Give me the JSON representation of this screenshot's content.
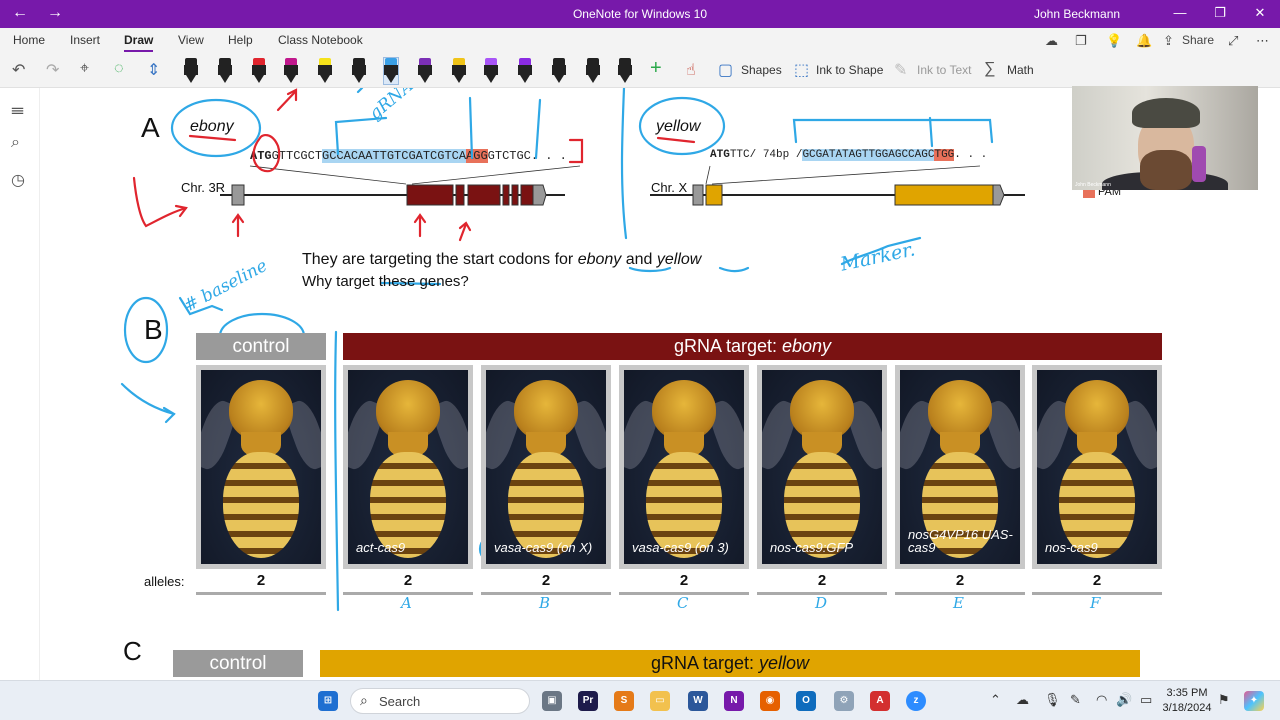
{
  "window": {
    "title": "OneNote for Windows 10",
    "user": "John Beckmann",
    "back_icon": "←",
    "forward_icon": "→",
    "minimize": "—",
    "maximize": "❐",
    "close": "✕"
  },
  "ribbon": {
    "tabs": [
      "Home",
      "Insert",
      "Draw",
      "View",
      "Help",
      "Class Notebook"
    ],
    "share": "Share"
  },
  "toolbar": {
    "shapes": "Shapes",
    "ink_to_shape": "Ink to Shape",
    "ink_to_text": "Ink to Text",
    "math": "Math",
    "pen_colors": [
      "#222222",
      "#222222",
      "#e0252e",
      "#c0188c",
      "#f5e21a",
      "#222222",
      "#3aa0e6",
      "#7b2fb5",
      "#f0c419",
      "#a855f7",
      "#8a2be2",
      "#222222",
      "#222222",
      "#222222"
    ]
  },
  "panelA": {
    "letter": "A",
    "ebony": "ebony",
    "yellow": "yellow",
    "chr3r": "Chr. 3R",
    "chrx": "Chr. X",
    "seq_ebony": {
      "start": "ATG",
      "pre": "GTTCGCT",
      "guide": "GCCACAATTGTCGATCGTC",
      "mid": "A",
      "pam": "AGG",
      "post": "GTCTGC. . ."
    },
    "seq_yellow": {
      "start": "ATG",
      "pre": "TTC/ 74bp /",
      "guide": "GCGATATAGTTGGAGCCAGC",
      "pam": "TGG",
      "post": ". . ."
    },
    "pam_legend": "PAM",
    "question1_pre": "They are targeting the start codons for ",
    "question1_ebony": "ebony",
    "question1_and": " and ",
    "question1_yellow": "yellow",
    "question2": "Why target these genes?"
  },
  "panelB": {
    "letter": "B",
    "control": "control",
    "target_label": "gRNA target: ",
    "target_gene": "ebony",
    "alleles_label": "alleles:",
    "flies": [
      {
        "caption": "",
        "alleles": "2",
        "letter": ""
      },
      {
        "caption": "act-cas9",
        "alleles": "2",
        "letter": "A"
      },
      {
        "caption": "vasa-cas9 (on X)",
        "alleles": "2",
        "letter": "B"
      },
      {
        "caption": "vasa-cas9 (on 3)",
        "alleles": "2",
        "letter": "C"
      },
      {
        "caption": "nos-cas9:GFP",
        "alleles": "2",
        "letter": "D"
      },
      {
        "caption": "nosG4VP16 UAS-cas9",
        "alleles": "2",
        "letter": "E"
      },
      {
        "caption": "nos-cas9",
        "alleles": "2",
        "letter": "F"
      }
    ]
  },
  "panelC": {
    "letter": "C",
    "control": "control",
    "target_label": "gRNA target: ",
    "target_gene": "yellow"
  },
  "annotations": {
    "grna": "gRNA",
    "baseline": "# baseline",
    "marker": "Marker."
  },
  "webcam": {
    "name": "John Beckmann"
  },
  "taskbar": {
    "search": "Search",
    "time": "3:35 PM",
    "date": "3/18/2024"
  },
  "colors": {
    "title_bar": "#7719aa",
    "ebony_bar": "#7a1212",
    "yellow_bar": "#e0a400",
    "ink_blue": "#2fa8e6",
    "ink_red": "#e0252e"
  }
}
